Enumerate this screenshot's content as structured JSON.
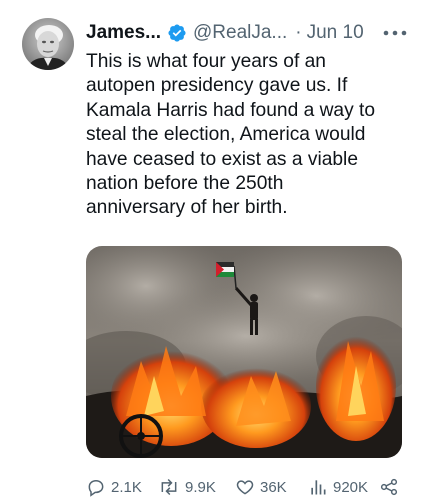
{
  "tweet": {
    "author_name": "James...",
    "handle": "@RealJa...",
    "separator": "·",
    "date": "Jun 10",
    "text": "This is what four years of an\nautopen presidency gave us. If\nKamala Harris had found a way to\nsteal the election, America would\nhave ceased to exist as a viable\nnation before the 250th\nanniversary of her birth.",
    "media_icon": "photo"
  },
  "actions": {
    "replies": "2.1K",
    "reposts": "9.9K",
    "likes": "36K",
    "views": "920K"
  },
  "icons": {
    "avatar": "avatar",
    "verified": "verified-badge-icon",
    "more": "more-icon",
    "reply": "reply-icon",
    "repost": "repost-icon",
    "like": "heart-icon",
    "views": "views-icon",
    "share": "share-icon"
  },
  "colors": {
    "text": "#0f1419",
    "secondary": "#536471",
    "verified": "#1d9bf0"
  }
}
